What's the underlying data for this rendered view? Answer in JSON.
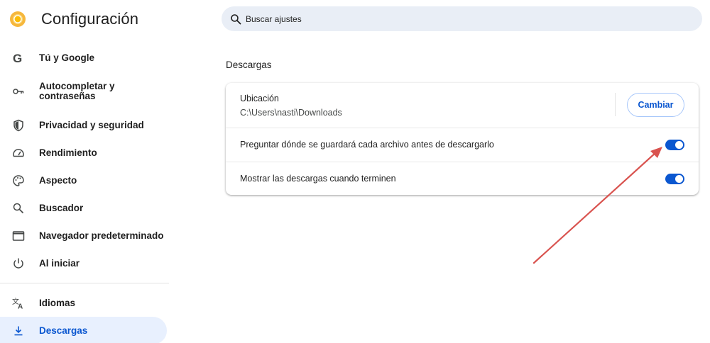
{
  "app": {
    "title": "Configuración"
  },
  "search": {
    "placeholder": "Buscar ajustes"
  },
  "sidebar": {
    "items": [
      {
        "label": "Tú y Google",
        "icon": "google-icon"
      },
      {
        "label": "Autocompletar y contraseñas",
        "icon": "key-icon"
      },
      {
        "label": "Privacidad y seguridad",
        "icon": "shield-icon"
      },
      {
        "label": "Rendimiento",
        "icon": "gauge-icon"
      },
      {
        "label": "Aspecto",
        "icon": "palette-icon"
      },
      {
        "label": "Buscador",
        "icon": "search-icon"
      },
      {
        "label": "Navegador predeterminado",
        "icon": "browser-window-icon"
      },
      {
        "label": "Al iniciar",
        "icon": "power-icon"
      },
      {
        "label": "Idiomas",
        "icon": "translate-icon"
      },
      {
        "label": "Descargas",
        "icon": "download-icon",
        "active": true
      }
    ]
  },
  "main": {
    "section_title": "Descargas",
    "location": {
      "label": "Ubicación",
      "value": "C:\\Users\\nasti\\Downloads",
      "button": "Cambiar"
    },
    "options": [
      {
        "label": "Preguntar dónde se guardará cada archivo antes de descargarlo",
        "enabled": true
      },
      {
        "label": "Mostrar las descargas cuando terminen",
        "enabled": true
      }
    ]
  },
  "colors": {
    "accent": "#0b57d0",
    "active_bg": "#e8f0fe",
    "search_bg": "#e9eef6",
    "annotation_arrow": "#d9534f"
  }
}
